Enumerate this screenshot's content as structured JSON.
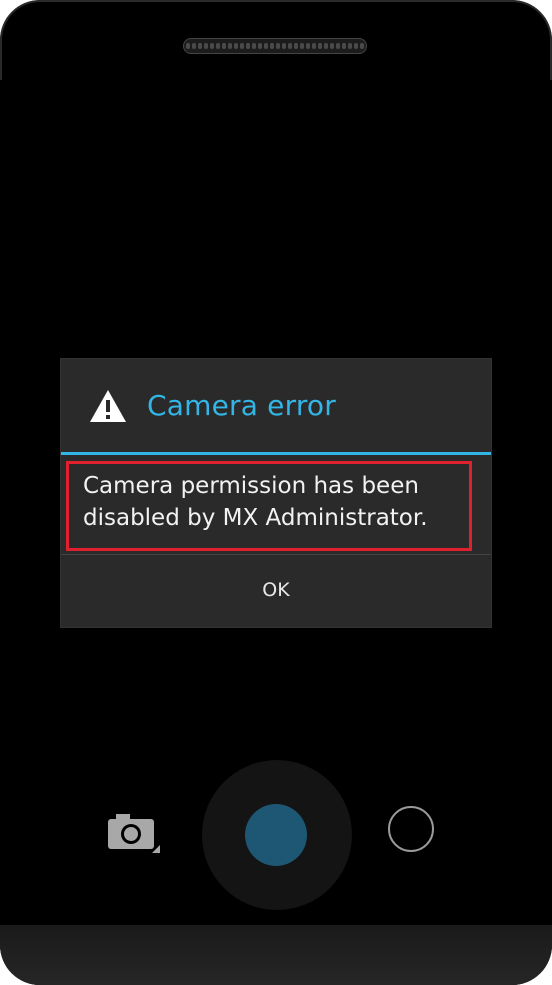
{
  "dialog": {
    "title": "Camera error",
    "message": "Camera permission has been disabled by MX Administrator.",
    "ok_label": "OK",
    "icon": "warning-icon"
  },
  "controls": {
    "switch_icon": "camera-switch-icon",
    "shutter_icon": "shutter-button",
    "mode_icon": "mode-circle-icon"
  },
  "colors": {
    "accent": "#33b5e5",
    "highlight": "#e0202c",
    "shutter": "#1d5774",
    "dialog_bg": "#2a2a2a"
  }
}
